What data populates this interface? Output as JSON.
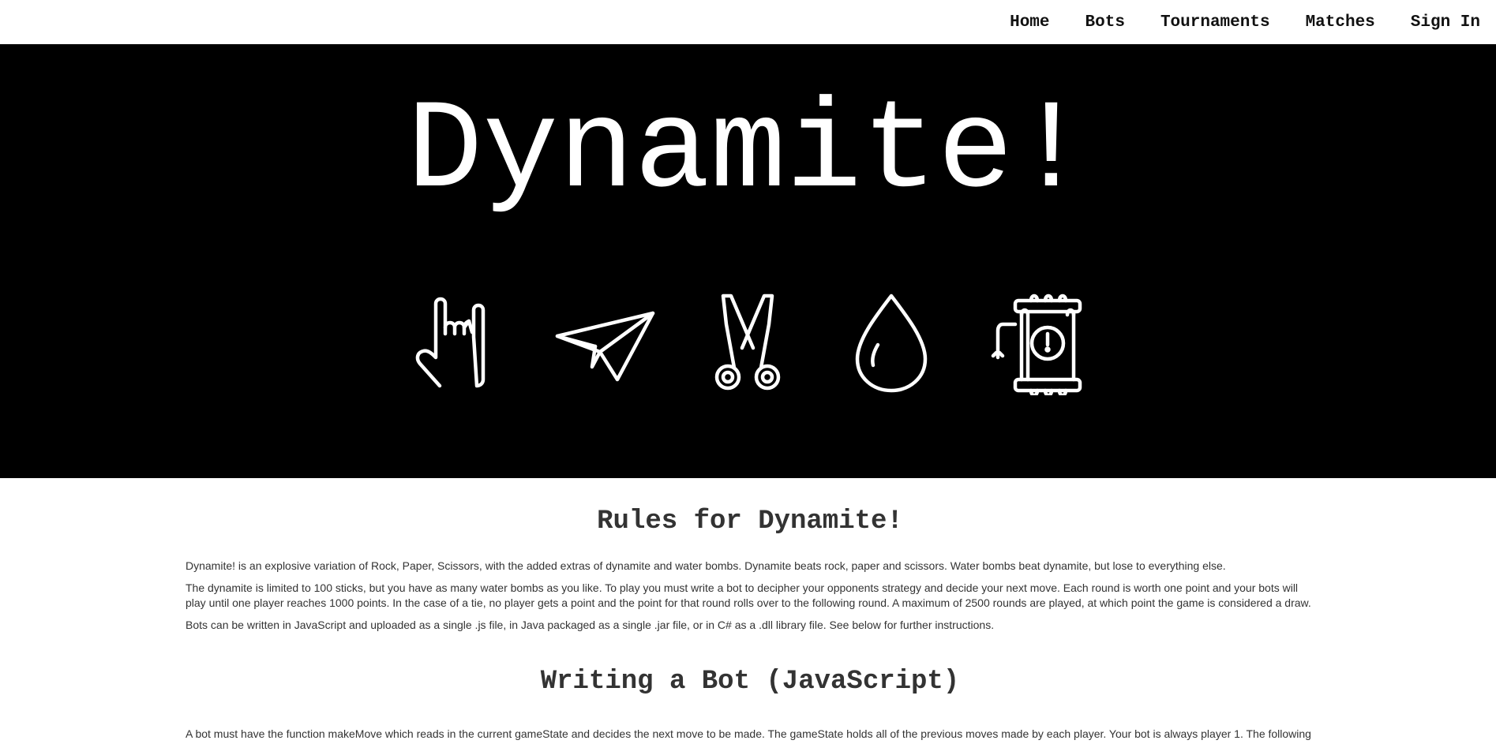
{
  "nav": {
    "links": [
      {
        "label": "Home"
      },
      {
        "label": "Bots"
      },
      {
        "label": "Tournaments"
      },
      {
        "label": "Matches"
      },
      {
        "label": "Sign In"
      }
    ]
  },
  "hero": {
    "title": "Dynamite!",
    "background": "#000000",
    "foreground": "#ffffff",
    "icons": [
      "rock-hand-icon",
      "paper-plane-icon",
      "scissors-icon",
      "water-drop-icon",
      "dynamite-icon"
    ]
  },
  "rules": {
    "heading": "Rules for Dynamite!",
    "paragraphs": [
      "Dynamite! is an explosive variation of Rock, Paper, Scissors, with the added extras of dynamite and water bombs. Dynamite beats rock, paper and scissors. Water bombs beat dynamite, but lose to everything else.",
      "The dynamite is limited to 100 sticks, but you have as many water bombs as you like. To play you must write a bot to decipher your opponents strategy and decide your next move. Each round is worth one point and your bots will play until one player reaches 1000 points. In the case of a tie, no player gets a point and the point for that round rolls over to the following round. A maximum of 2500 rounds are played, at which point the game is considered a draw.",
      "Bots can be written in JavaScript and uploaded as a single .js file, in Java packaged as a single .jar file, or in C# as a .dll library file. See below for further instructions."
    ]
  },
  "writing": {
    "heading": "Writing a Bot (JavaScript)",
    "paragraph": "A bot must have the function makeMove which reads in the current gameState and decides the next move to be made. The gameState holds all of the previous moves made by each player. Your bot is always player 1. The following code snippet shows the form of the gameState, with an empty string as a placeholder value for all of the previous moves."
  }
}
